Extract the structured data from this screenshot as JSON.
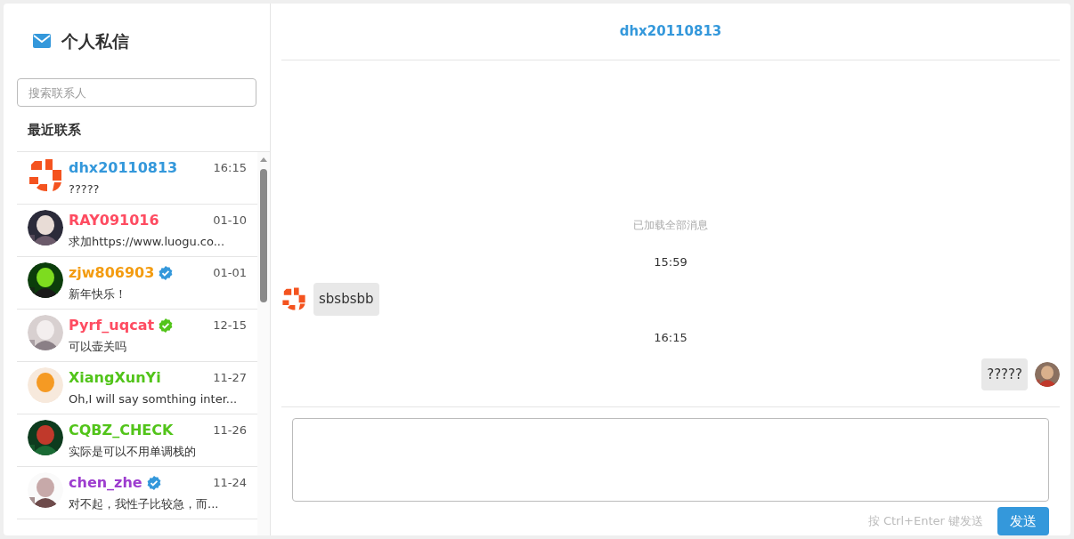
{
  "sidebar": {
    "title": "个人私信",
    "search": {
      "placeholder": "搜索联系人"
    },
    "section_label": "最近联系",
    "contacts": [
      {
        "name": "dhx20110813",
        "color": "#3498db",
        "time": "16:15",
        "preview": "?????",
        "kind": "logo"
      },
      {
        "name": "RAY091016",
        "color": "#fe4c61",
        "time": "01-10",
        "preview": "求加https://www.luogu.co..."
      },
      {
        "name": "zjw806903",
        "color": "#f39c11",
        "time": "01-01",
        "preview": "新年快乐！",
        "badge": {
          "color": "#3498db"
        }
      },
      {
        "name": "Pyrf_uqcat",
        "color": "#fe4c61",
        "time": "12-15",
        "preview": "可以壶关吗",
        "badge": {
          "color": "#52c41a"
        }
      },
      {
        "name": "XiangXunYi",
        "color": "#52c41a",
        "time": "11-27",
        "preview": "Oh,I will say somthing inter..."
      },
      {
        "name": "CQBZ_CHECK",
        "color": "#52c41a",
        "time": "11-26",
        "preview": "实际是可以不用单调栈的"
      },
      {
        "name": "chen_zhe",
        "color": "#9d3dcf",
        "time": "11-24",
        "preview": "对不起，我性子比较急，而...",
        "badge": {
          "color": "#3498db"
        }
      }
    ]
  },
  "chat": {
    "title": "dhx20110813",
    "loaded_note": "已加载全部消息",
    "messages": [
      {
        "kind": "time",
        "text": "15:59"
      },
      {
        "kind": "received",
        "text": "sbsbsbb"
      },
      {
        "kind": "time",
        "text": "16:15"
      },
      {
        "kind": "sent",
        "text": "?????"
      }
    ],
    "composer": {
      "hint": "按 Ctrl+Enter 键发送",
      "send_label": "发送"
    }
  }
}
